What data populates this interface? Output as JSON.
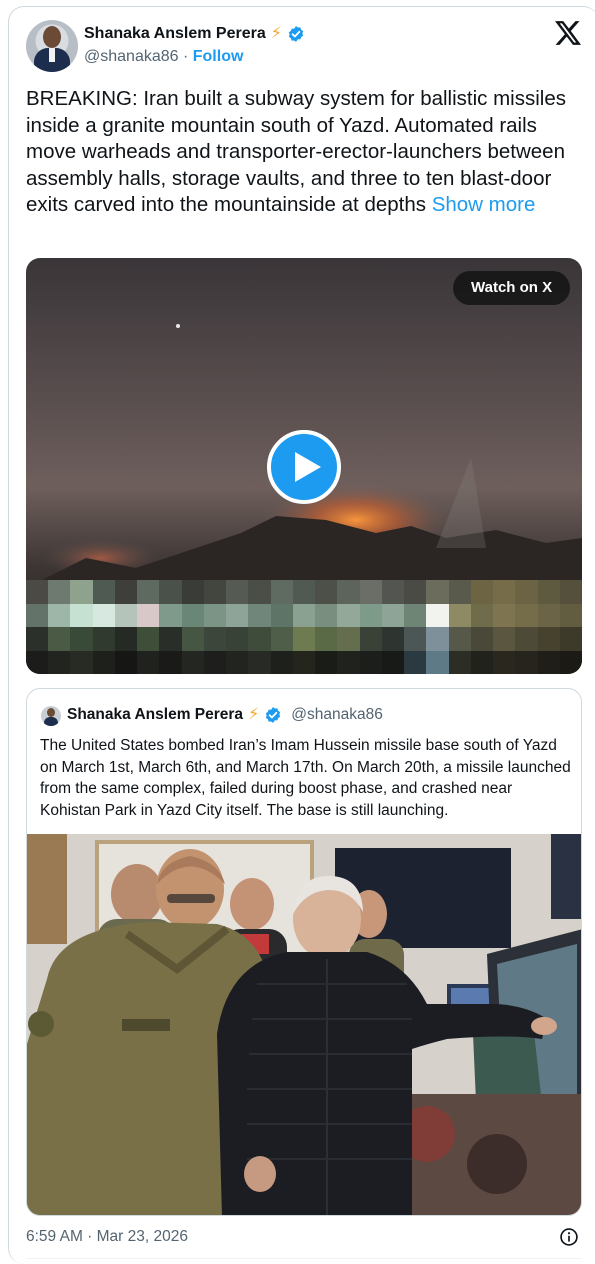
{
  "author": {
    "name": "Shanaka Anslem Perera",
    "badge_emoji": "⚡",
    "handle": "@shanaka86",
    "separator": " · ",
    "follow_label": "Follow"
  },
  "tweet": {
    "text": "BREAKING: Iran built a subway system for ballistic missiles inside a granite mountain south of Yazd. Automated rails move warheads and transporter-erector-launchers between assembly halls, storage vaults, and three to ten blast-door exits carved into the mountainside at depths ",
    "show_more_label": "Show more"
  },
  "video": {
    "watch_label": "Watch on X"
  },
  "quote": {
    "name": "Shanaka Anslem Perera",
    "badge_emoji": "⚡",
    "handle": "@shanaka86",
    "text": "The United States bombed Iran’s Imam Hussein missile base south of Yazd on March 1st, March 6th, and March 17th. On March 20th, a missile launched from the same complex, failed during boost phase, and crashed near Kohistan Park in Yazd City itself. The base is still launching."
  },
  "footer": {
    "timestamp": "6:59 AM · Mar 23, 2026"
  },
  "colors": {
    "accent": "#1d9bf0",
    "text": "#0f1419",
    "muted": "#536471",
    "border": "#cfd9de"
  },
  "icons": [
    "x-logo-icon",
    "verified-badge-icon",
    "lightning-emoji-icon",
    "play-icon",
    "info-icon"
  ]
}
